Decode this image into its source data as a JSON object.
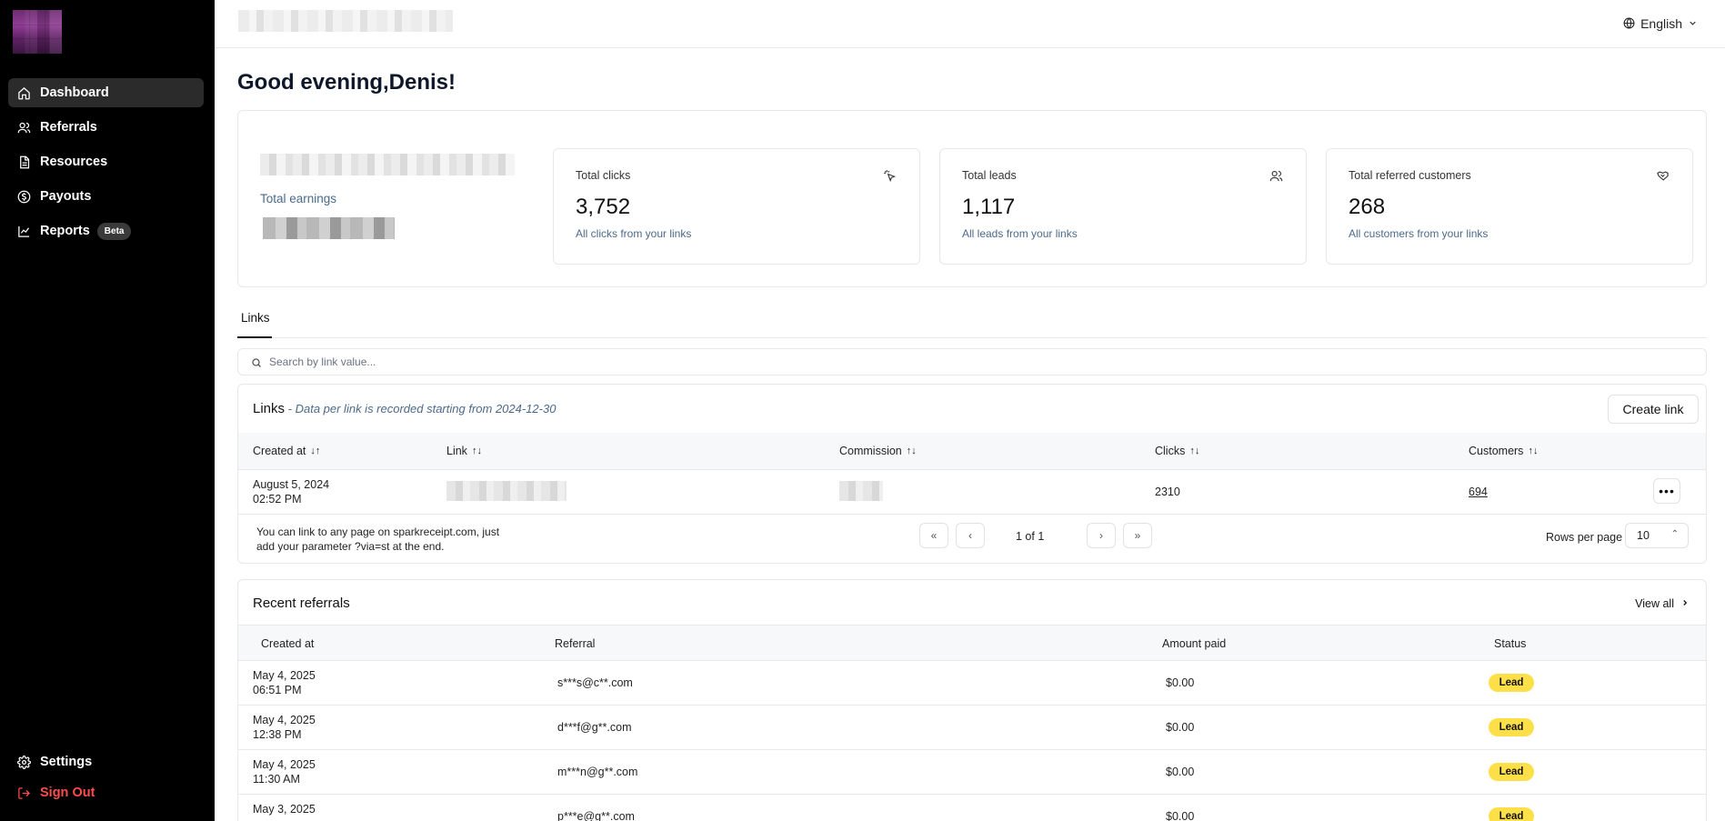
{
  "sidebar": {
    "items": [
      {
        "label": "Dashboard",
        "icon": "home-icon"
      },
      {
        "label": "Referrals",
        "icon": "users-icon"
      },
      {
        "label": "Resources",
        "icon": "document-icon"
      },
      {
        "label": "Payouts",
        "icon": "dollar-circle-icon"
      },
      {
        "label": "Reports",
        "icon": "line-chart-icon",
        "badge": "Beta"
      }
    ],
    "bottom": [
      {
        "label": "Settings",
        "icon": "gear-icon"
      },
      {
        "label": "Sign Out",
        "icon": "sign-out-icon"
      }
    ]
  },
  "header": {
    "language": "English"
  },
  "greeting": "Good evening,Denis!",
  "stats": {
    "earnings_label": "Total earnings",
    "cards": [
      {
        "label": "Total clicks",
        "value": "3,752",
        "sub": "All clicks from your links",
        "icon": "pointer-click-icon"
      },
      {
        "label": "Total leads",
        "value": "1,117",
        "sub": "All leads from your links",
        "icon": "users-icon"
      },
      {
        "label": "Total referred customers",
        "value": "268",
        "sub": "All customers from your links",
        "icon": "handshake-icon"
      }
    ]
  },
  "tabs": [
    "Links"
  ],
  "search": {
    "placeholder": "Search by link value..."
  },
  "links": {
    "title": "Links",
    "subtitle": " - Data per link is recorded starting from 2024-12-30",
    "create_label": "Create link",
    "columns": [
      "Created at",
      "Link",
      "Commission",
      "Clicks",
      "Customers"
    ],
    "rows": [
      {
        "date": "August 5, 2024",
        "time": "02:52 PM",
        "clicks": "2310",
        "customers": "694"
      }
    ],
    "footnote": "You can link to any page on sparkreceipt.com, just add your parameter ?via=st at the end.",
    "page_info": "1 of 1",
    "rows_per_page_label": "Rows per page",
    "rows_per_page": "10"
  },
  "referrals": {
    "title": "Recent referrals",
    "view_all": "View all",
    "columns": [
      "Created at",
      "Referral",
      "Amount paid",
      "Status"
    ],
    "rows": [
      {
        "date": "May 4, 2025",
        "time": "06:51 PM",
        "referral": "s***s@c**.com",
        "amount": "$0.00",
        "status": "Lead"
      },
      {
        "date": "May 4, 2025",
        "time": "12:38 PM",
        "referral": "d***f@g**.com",
        "amount": "$0.00",
        "status": "Lead"
      },
      {
        "date": "May 4, 2025",
        "time": "11:30 AM",
        "referral": "m***n@g**.com",
        "amount": "$0.00",
        "status": "Lead"
      },
      {
        "date": "May 3, 2025",
        "time": "",
        "referral": "p***e@g**.com",
        "amount": "$0.00",
        "status": "Lead"
      }
    ]
  },
  "colors": {
    "sidebar_bg": "#000000",
    "badge_lead": "#fde047",
    "signout": "#ff4d4f",
    "muted_blue": "#4b6a8a"
  }
}
